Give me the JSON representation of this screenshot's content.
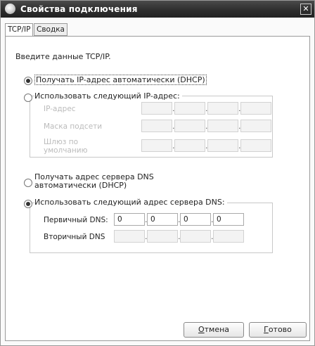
{
  "window": {
    "title": "Свойства подключения",
    "close_label": "✕"
  },
  "tabs": [
    {
      "label": "TCP/IP"
    },
    {
      "label": "Сводка"
    }
  ],
  "intro": "Введите данные TCP/IP.",
  "ip_mode": {
    "auto_label": "Получать IP-адрес автоматически (DHCP)",
    "manual_label": "Использовать следующий IP-адрес:",
    "fields": [
      {
        "label": "IP-адрес",
        "octets": [
          "",
          "",
          "",
          ""
        ]
      },
      {
        "label": "Маска подсети",
        "octets": [
          "",
          "",
          "",
          ""
        ]
      },
      {
        "label": "Шлюз по умолчанию",
        "label_line1": "Шлюз по",
        "label_line2": "умолчанию",
        "octets": [
          "",
          "",
          "",
          ""
        ]
      }
    ]
  },
  "dns_mode": {
    "auto_label_line1": "Получать адрес сервера DNS",
    "auto_label_line2": "автоматически (DHCP)",
    "manual_label": "Использовать следующий адрес сервера DNS:",
    "primary": {
      "label": "Первичный DNS:",
      "octets": [
        "0",
        "0",
        "0",
        "0"
      ]
    },
    "secondary": {
      "label": "Вторичный DNS",
      "octets": [
        "",
        "",
        "",
        ""
      ]
    }
  },
  "buttons": {
    "cancel_first": "О",
    "cancel_rest": "тмена",
    "ok_first": "Г",
    "ok_rest": "отово"
  }
}
